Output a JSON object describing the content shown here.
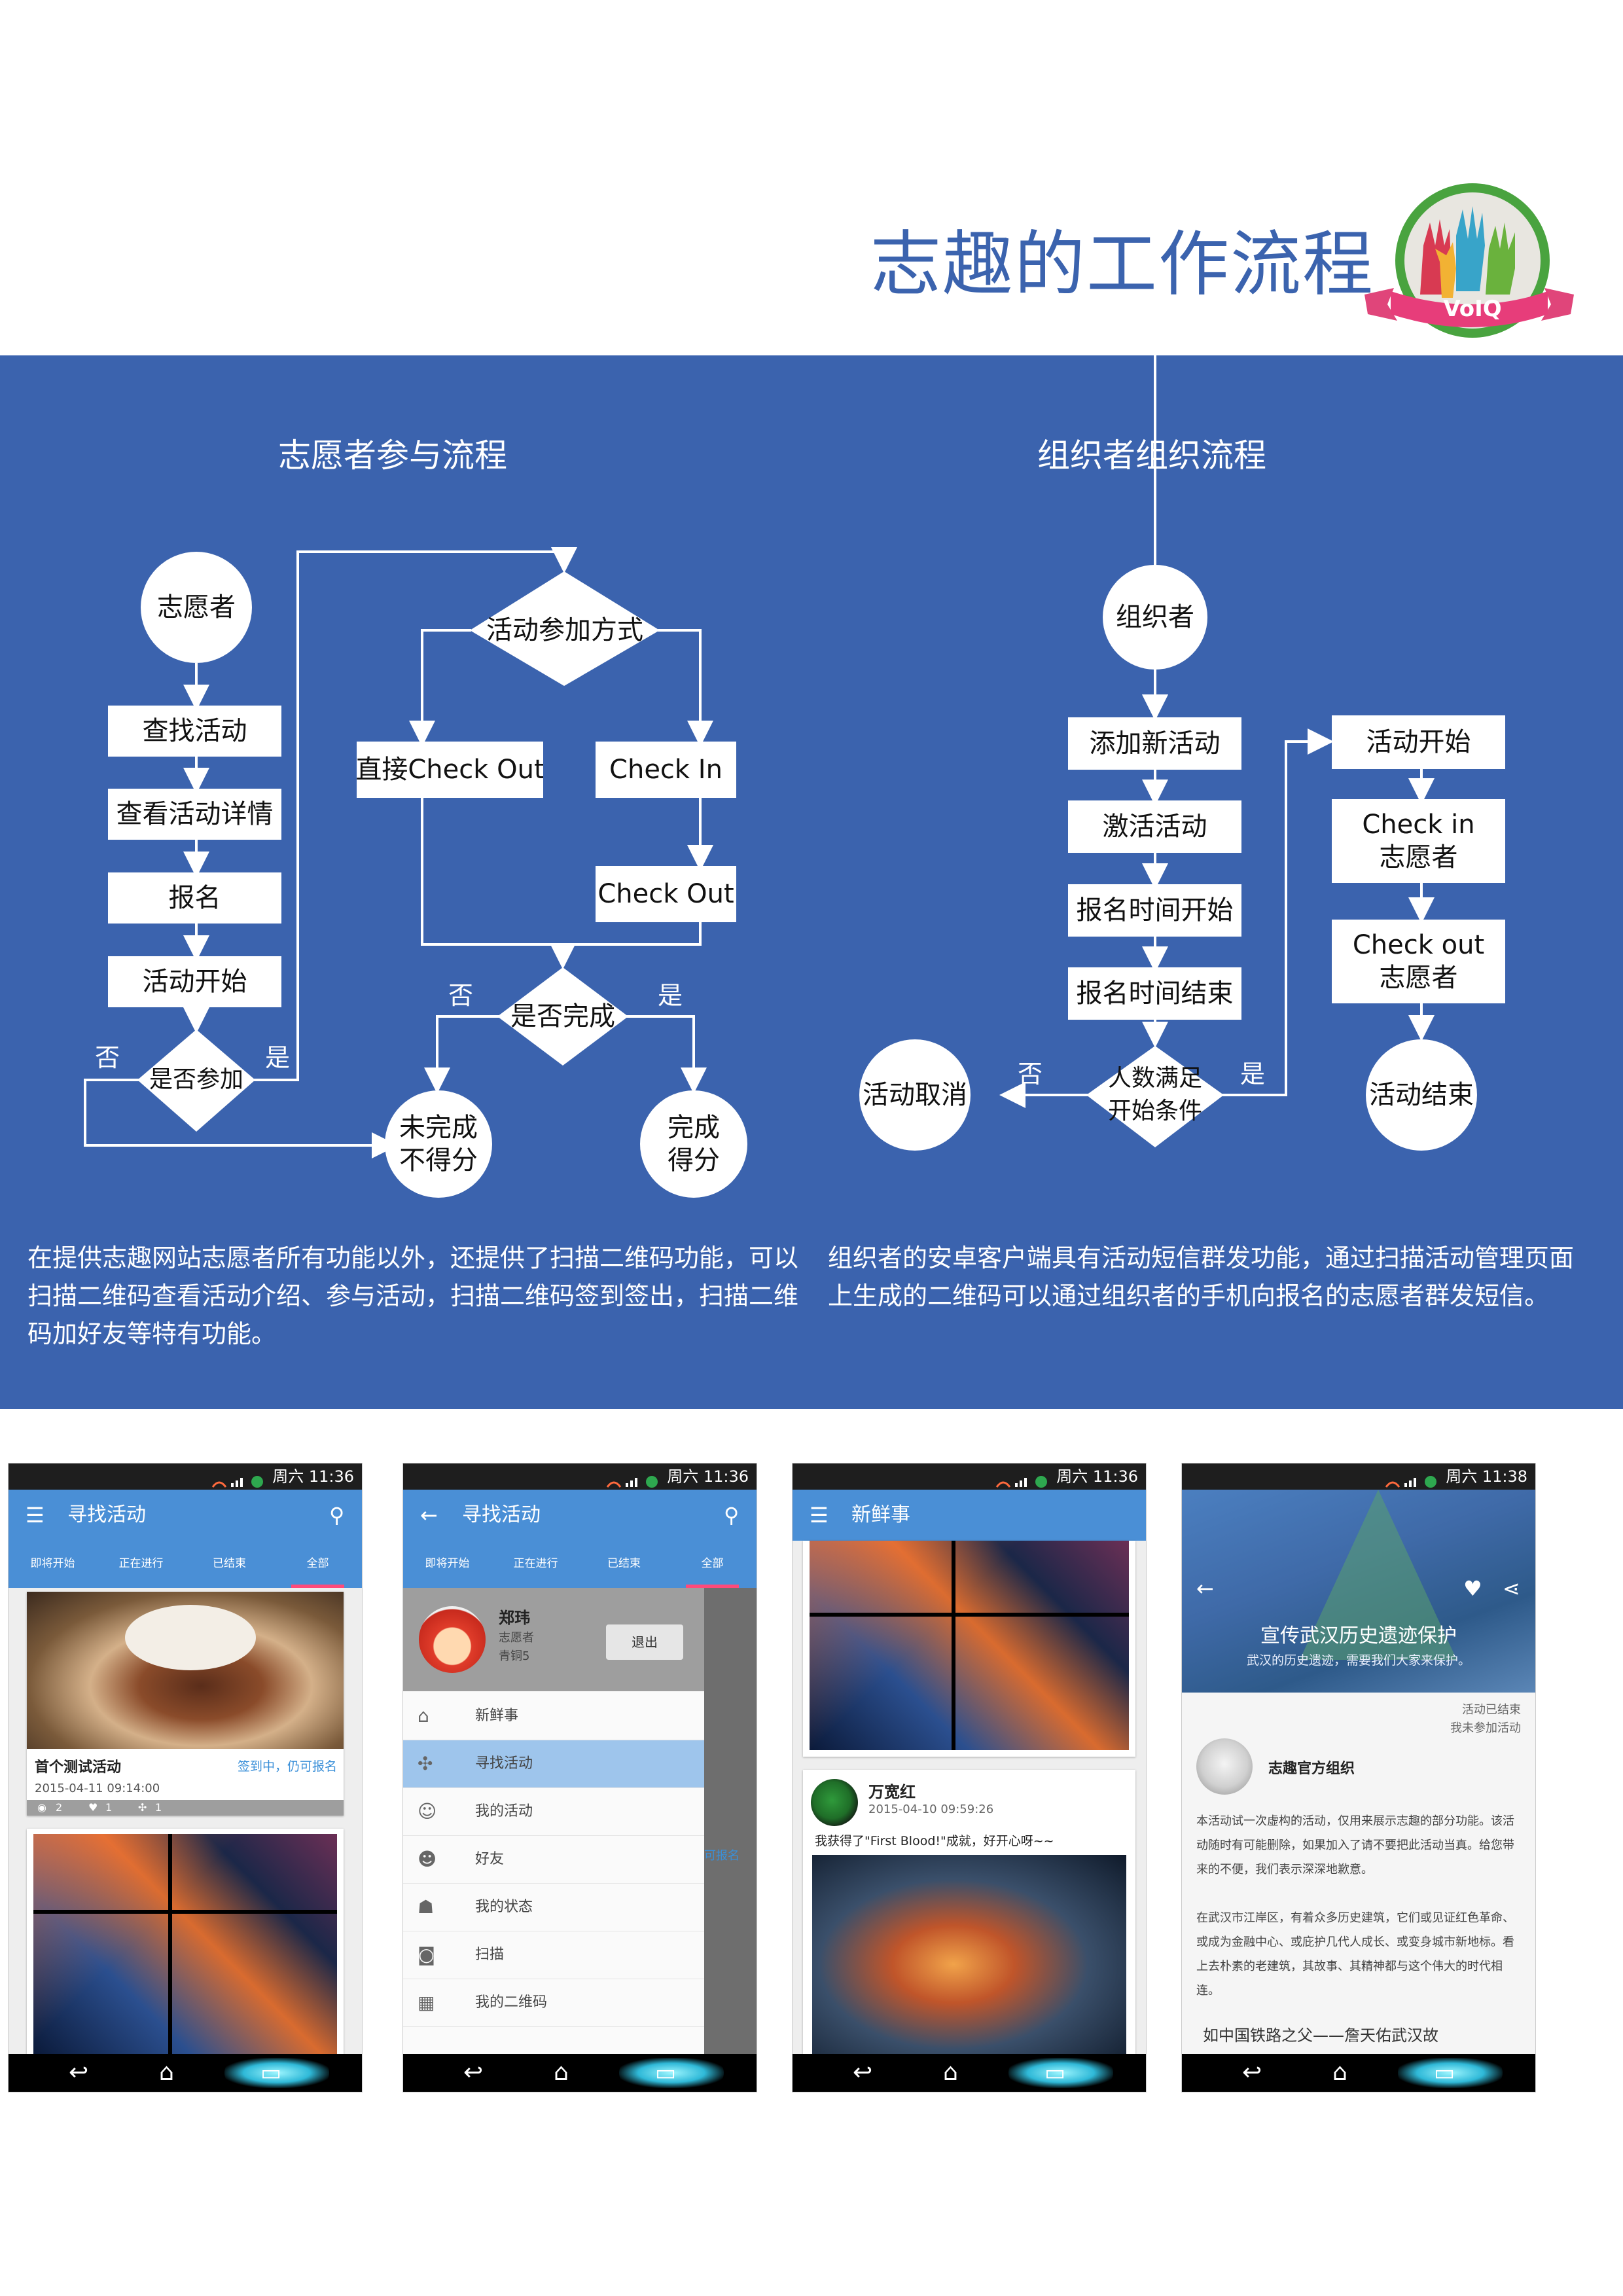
{
  "header": {
    "title": "志趣的工作流程",
    "logo_text": "VoIQ"
  },
  "volunteer_flow": {
    "title": "志愿者参与流程",
    "start": "志愿者",
    "steps": [
      "查找活动",
      "查看活动详情",
      "报名",
      "活动开始"
    ],
    "decision_join": "是否参加",
    "decision_mode": "活动参加方式",
    "direct_checkout": "直接Check Out",
    "check_in": "Check In",
    "check_out": "Check Out",
    "decision_done": "是否完成",
    "not_done": "未完成\n不得分",
    "done": "完成\n得分",
    "yes": "是",
    "no": "否",
    "description": "在提供志趣网站志愿者所有功能以外，还提供了扫描二维码功能，可以扫描二维码查看活动介绍、参与活动，扫描二维码签到签出，扫描二维码加好友等特有功能。"
  },
  "organizer_flow": {
    "title": "组织者组织流程",
    "start": "组织者",
    "steps": [
      "添加新活动",
      "激活活动",
      "报名时间开始",
      "报名时间结束"
    ],
    "decision": "人数满足\n开始条件",
    "cancel": "活动取消",
    "right_steps": [
      "活动开始",
      "Check in\n志愿者",
      "Check out\n志愿者"
    ],
    "end": "活动结束",
    "yes": "是",
    "no": "否",
    "description": "组织者的安卓客户端具有活动短信群发功能，通过扫描活动管理页面上生成的二维码可以通过组织者的手机向报名的志愿者群发短信。"
  },
  "phones": {
    "time1": "周六 11:36",
    "time2": "周六 11:36",
    "time3": "周六 11:36",
    "time4": "周六 11:38",
    "tabs": [
      "即将开始",
      "正在进行",
      "已结束",
      "全部"
    ],
    "p1": {
      "title": "寻找活动",
      "card_title": "首个测试活动",
      "card_status": "签到中，仍可报名",
      "card_time": "2015-04-11 09:14:00",
      "stats": [
        "2",
        "1",
        "1"
      ]
    },
    "p2": {
      "title": "寻找活动",
      "user_name": "郑玮",
      "user_role": "志愿者",
      "user_level": "青铜5",
      "logout": "退出",
      "behind_text": "可报名",
      "menu": [
        {
          "icon": "home-icon",
          "glyph": "⌂",
          "label": "新鲜事"
        },
        {
          "icon": "gamepad-icon",
          "glyph": "✣",
          "label": "寻找活动"
        },
        {
          "icon": "add-user-icon",
          "glyph": "☺",
          "label": "我的活动"
        },
        {
          "icon": "group-icon",
          "glyph": "☻",
          "label": "好友"
        },
        {
          "icon": "person-icon",
          "glyph": "☗",
          "label": "我的状态"
        },
        {
          "icon": "camera-icon",
          "glyph": "◙",
          "label": "扫描"
        },
        {
          "icon": "qrcode-icon",
          "glyph": "▦",
          "label": "我的二维码"
        }
      ]
    },
    "p3": {
      "title": "新鲜事",
      "user_name": "万宽红",
      "post_time": "2015-04-10 09:59:26",
      "post_text": "我获得了\"First Blood!\"成就，好开心呀~~"
    },
    "p4": {
      "banner_title": "宣传武汉历史遗迹保护",
      "banner_sub": "武汉的历史遗迹，需要我们大家来保护。",
      "status_line1": "活动已结束",
      "status_line2": "我未参加活动",
      "org_name": "志趣官方组织",
      "para1": "本活动试一次虚构的活动，仅用来展示志趣的部分功能。该活动随时有可能删除，如果加入了请不要把此活动当真。给您带来的不便，我们表示深深地歉意。",
      "para2": "在武汉市江岸区，有着众多历史建筑，它们或见证红色革命、或成为金融中心、或庇护几代人成长、或变身城市新地标。看上去朴素的老建筑，其故事、其精神都与这个伟大的时代相连。",
      "footer": "如中国铁路之父——詹天佑武汉故"
    }
  },
  "colors": {
    "panel_blue": "#3b63ae",
    "appbar_blue": "#4a8fd6",
    "title_blue": "#3b63ae"
  }
}
